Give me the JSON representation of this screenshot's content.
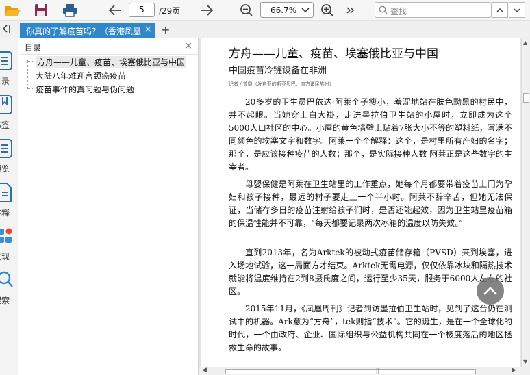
{
  "toolbar": {
    "open_icon": "folder-open-icon",
    "save_icon": "save-icon",
    "print_icon": "print-icon",
    "prev_icon": "arrow-left-icon",
    "page_current": "5",
    "page_total": "/29页",
    "next_icon": "arrow-right-icon",
    "zoom_out_icon": "zoom-out-icon",
    "zoom_value": "66.7%",
    "zoom_in_icon": "zoom-in-icon",
    "more_icon": "double-chevron-right-icon",
    "search_placeholder": "查找",
    "colors": {
      "accent": "#2f86c9",
      "folder": "#f0a91b",
      "save": "#8b2a4f"
    }
  },
  "tabs": {
    "collapse_label": "<|",
    "active_tab": "你真的了解疫苗吗？（香港凤凰周刊）",
    "add_label": "+"
  },
  "rail": {
    "items": [
      {
        "label": "目录",
        "icon": "toc-icon"
      },
      {
        "label": "书签",
        "icon": "bookmark-icon"
      },
      {
        "label": "预览",
        "icon": "preview-icon"
      },
      {
        "label": "注释",
        "icon": "annotation-icon"
      },
      {
        "label": "发现",
        "icon": "discover-icon"
      },
      {
        "label": "搜索",
        "icon": "search-icon"
      }
    ]
  },
  "outline": {
    "title": "目录",
    "items": [
      "方舟——儿童、疫苗、埃塞俄比亚与中国",
      "大陆八年难迎宫颈癌疫苗",
      "疫苗事件的真问题与伪问题"
    ]
  },
  "document": {
    "title": "方舟——儿童、疫苗、埃塞俄比亚与中国",
    "subtitle": "中国疫苗冷链设备在非洲",
    "byline": "记者 / 曾鼎（发自亚的斯亚贝巴、南方诸民族州）",
    "paragraphs": [
      "20多岁的卫生员巴依达·阿莱个子瘦小，羞涩地站在肤色黝黑的村民中，并不起眼。当她穿上白大褂，走进墨拉伯卫生站的小屋时，立即成为这个5000人口社区的中心。小屋的黄色墙壁上贴着7张大小不等的塑料纸，写满不同颜色的埃塞文字和数字。阿莱一个个解释：这个，是村里所有产妇的名字；那个，是应该接种疫苗的人数；那个，是实际接种人数 阿莱正是这些数字的主宰者。",
      "母婴保健是阿莱在卫生站里的工作重点，她每个月都要带着疫苗上门为孕妇和孩子接种，最远的村子要走上一个半小时。阿莱不辞辛苦，但她无法保证，当储存多日的疫苗注射给孩子们时，是否还能起效，因为卫生站里疫苗箱的保温性能并不可靠，“每天都要记录两次冰箱的温度以防失效。”",
      "直到2013年，名为Arktek的被动式疫苗储存箱（PVSD）来到埃塞，进入场地试验，这一局面方才结束。Arktek无需电源，仅仅依靠冰块和隔热技术就能将温度维持在2到8摄氏度之间，运行至少35天，服务于6000人左右的社区。",
      "2015年11月，《凤凰周刊》记者到访墨拉伯卫生站时，见到了这台仍在测试中的机器。Ark意为“方舟”，tek则指“技术”。它的诞生，是在一个全球化的时代，一个由政府、企业、国际组织与公益机构共同在一个极度落后的地区拯救生命的故事。"
    ]
  }
}
